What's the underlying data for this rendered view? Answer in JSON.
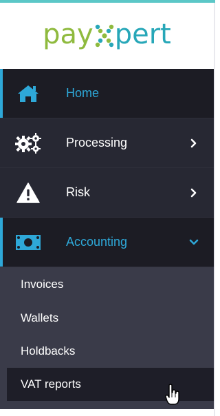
{
  "logo": {
    "part1": "pay",
    "part2": "pert"
  },
  "nav": {
    "items": [
      {
        "label": "Home",
        "icon": "home-icon"
      },
      {
        "label": "Processing",
        "icon": "gears-icon"
      },
      {
        "label": "Risk",
        "icon": "warning-icon"
      },
      {
        "label": "Accounting",
        "icon": "money-icon"
      }
    ]
  },
  "submenu": {
    "items": [
      {
        "label": "Invoices"
      },
      {
        "label": "Wallets"
      },
      {
        "label": "Holdbacks"
      },
      {
        "label": "VAT reports"
      }
    ]
  },
  "colors": {
    "accent": "#2ea8d8",
    "sidebar_bg": "#272833",
    "active_bg": "#1c1c24",
    "submenu_bg": "#3a3b49",
    "logo_green": "#8fba3e",
    "logo_teal": "#27a7b8",
    "top_bar": "#5bc7c7"
  }
}
